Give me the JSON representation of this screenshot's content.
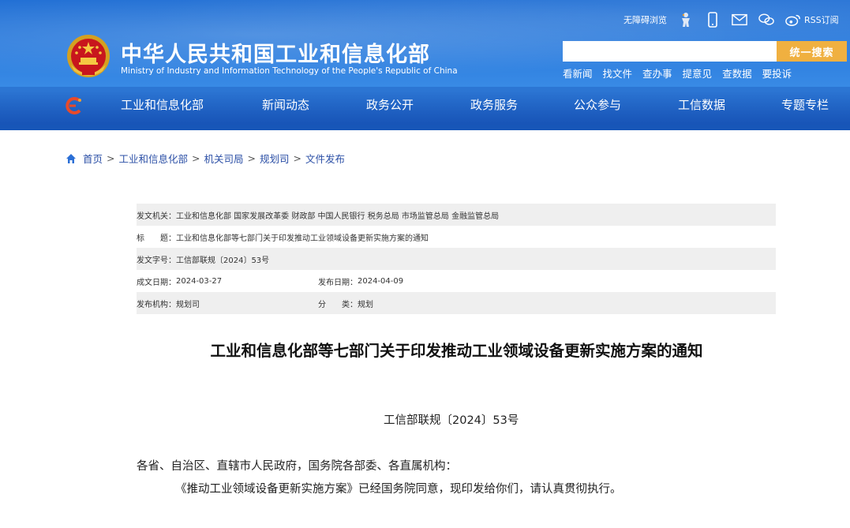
{
  "header": {
    "title_cn": "中华人民共和国工业和信息化部",
    "title_en": "Ministry of Industry and Information Technology of the People's Republic of China",
    "accessibility": "无障碍浏览",
    "rss": "RSS订阅",
    "icons": [
      "accessibility-figure-icon",
      "mobile-icon",
      "mail-icon",
      "wechat-icon",
      "weibo-icon"
    ],
    "search_placeholder": "",
    "search_button": "统一搜索",
    "quick_links": [
      "看新闻",
      "找文件",
      "查办事",
      "提意见",
      "查数据",
      "要投诉"
    ],
    "nav": [
      "工业和信息化部",
      "新闻动态",
      "政务公开",
      "政务服务",
      "公众参与",
      "工信数据",
      "专题专栏"
    ],
    "colors": {
      "header_blue": "#2f80e0",
      "search_btn": "#f0b040",
      "breadcrumb_link": "#2b4fa6"
    }
  },
  "breadcrumb": [
    "首页",
    "工业和信息化部",
    "机关司局",
    "规划司",
    "文件发布"
  ],
  "meta": {
    "issuer_label": "发文机关：",
    "issuer": "工业和信息化部 国家发展改革委 财政部 中国人民银行 税务总局 市场监管总局 金融监管总局",
    "title_label": "标　　题：",
    "title": "工业和信息化部等七部门关于印发推动工业领域设备更新实施方案的通知",
    "doc_no_label": "发文字号：",
    "doc_no": "工信部联规〔2024〕53号",
    "created_label": "成文日期：",
    "created": "2024-03-27",
    "published_label": "发布日期：",
    "published": "2024-04-09",
    "org_label": "发布机构：",
    "org": "规划司",
    "category_label": "分　　类：",
    "category": "规划"
  },
  "article": {
    "title": "工业和信息化部等七部门关于印发推动工业领域设备更新实施方案的通知",
    "doc_number": "工信部联规〔2024〕53号",
    "salutation": "各省、自治区、直辖市人民政府，国务院各部委、各直属机构：",
    "paragraph1": "《推动工业领域设备更新实施方案》已经国务院同意，现印发给你们，请认真贯彻执行。"
  }
}
